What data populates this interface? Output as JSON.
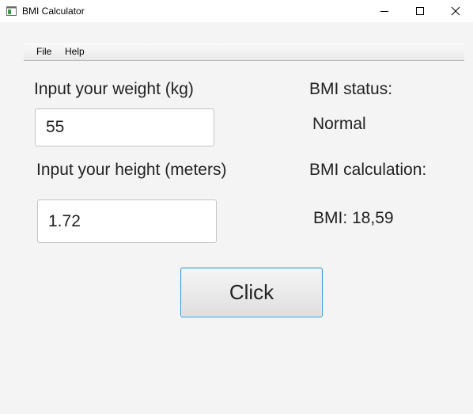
{
  "window": {
    "title": "BMI Calculator",
    "app_icon": "java-app-icon",
    "controls": [
      "minimize-icon",
      "maximize-icon",
      "close-icon"
    ]
  },
  "menu": {
    "items": [
      {
        "label": "File"
      },
      {
        "label": "Help"
      }
    ]
  },
  "form": {
    "weight_label": "Input your weight (kg)",
    "weight_value": "55",
    "height_label": "Input your height (meters)",
    "height_value": "1.72",
    "button_label": "Click"
  },
  "result": {
    "status_label": "BMI status:",
    "status_value": "Normal",
    "calc_label": "BMI calculation:",
    "bmi_value": "BMI: 18,59"
  },
  "colors": {
    "background": "#f4f4f4",
    "button_focus_border": "#3b9ad8"
  }
}
